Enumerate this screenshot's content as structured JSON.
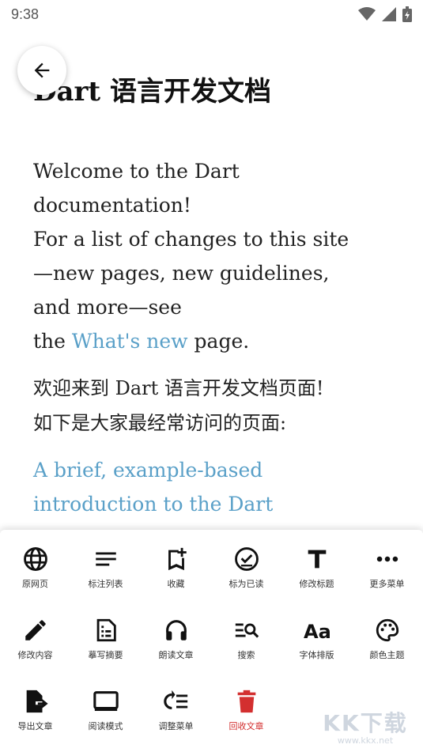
{
  "status": {
    "time": "9:38"
  },
  "page": {
    "title": "Dart 语言开发文档"
  },
  "content": {
    "p1_lines": [
      "Welcome to the Dart",
      "documentation!",
      "For a list of changes to this site",
      "—new pages, new guidelines,",
      "and more—see"
    ],
    "p1_last_prefix": "the ",
    "p1_link": "What's new",
    "p1_last_suffix": " page.",
    "p2_lines": [
      "欢迎来到 Dart 语言开发文档页面!",
      "如下是大家最经常访问的页面:"
    ],
    "p3_link_lines": [
      "A brief, example-based",
      "introduction to the Dart"
    ]
  },
  "menu": {
    "items": [
      {
        "label": "原网页",
        "icon": "globe-icon"
      },
      {
        "label": "标注列表",
        "icon": "list-icon"
      },
      {
        "label": "收藏",
        "icon": "bookmark-add-icon"
      },
      {
        "label": "标为已读",
        "icon": "check-circle-icon"
      },
      {
        "label": "修改标题",
        "icon": "title-icon"
      },
      {
        "label": "更多菜单",
        "icon": "more-icon"
      },
      {
        "label": "修改内容",
        "icon": "pencil-icon"
      },
      {
        "label": "摹写摘要",
        "icon": "summary-icon"
      },
      {
        "label": "朗读文章",
        "icon": "headphones-icon"
      },
      {
        "label": "搜索",
        "icon": "search-list-icon"
      },
      {
        "label": "字体排版",
        "icon": "font-icon"
      },
      {
        "label": "颜色主题",
        "icon": "palette-icon"
      },
      {
        "label": "导出文章",
        "icon": "export-icon"
      },
      {
        "label": "阅读模式",
        "icon": "reading-mode-icon"
      },
      {
        "label": "调整菜单",
        "icon": "adjust-menu-icon"
      },
      {
        "label": "回收文章",
        "icon": "trash-icon"
      }
    ],
    "danger_color": "#d32f2f"
  },
  "watermark": {
    "brand": "KK下载",
    "url": "www.kkx.net"
  }
}
